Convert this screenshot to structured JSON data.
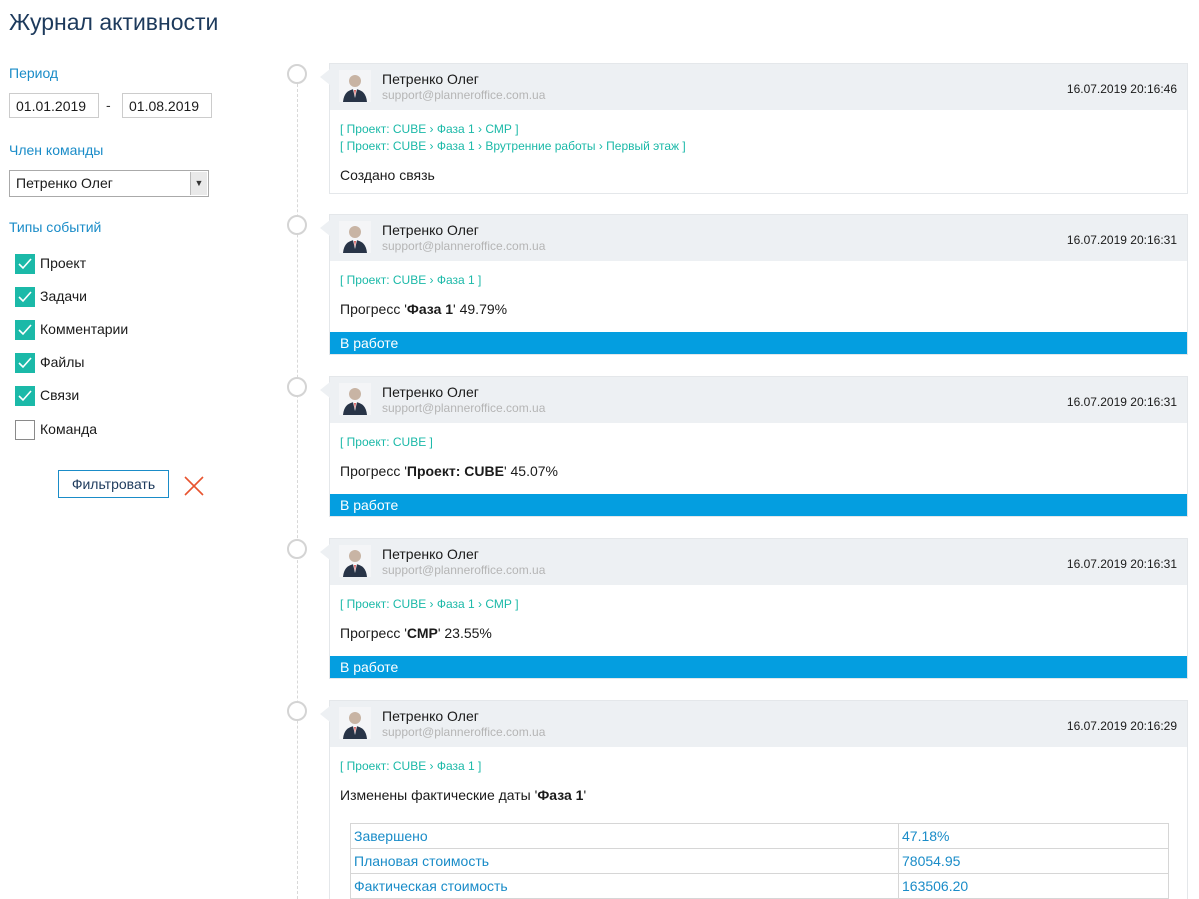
{
  "page": {
    "title": "Журнал активности"
  },
  "filters": {
    "period_label": "Период",
    "date_from": "01.01.2019",
    "date_separator": "-",
    "date_to": "01.08.2019",
    "member_label": "Член команды",
    "member_selected": "Петренко Олег",
    "event_types_label": "Типы событий",
    "event_types": [
      {
        "label": "Проект",
        "checked": true
      },
      {
        "label": "Задачи",
        "checked": true
      },
      {
        "label": "Комментарии",
        "checked": true
      },
      {
        "label": "Файлы",
        "checked": true
      },
      {
        "label": "Связи",
        "checked": true
      },
      {
        "label": "Команда",
        "checked": false
      }
    ],
    "filter_button": "Фильтровать"
  },
  "colors": {
    "accent": "#1a8cc8",
    "teal": "#1bb9a8",
    "status_bar": "#049ee0",
    "clear_icon": "#e8542f"
  },
  "activities": [
    {
      "user": "Петренко Олег",
      "email": "support@planneroffice.com.ua",
      "timestamp": "16.07.2019 20:16:46",
      "breadcrumbs": [
        "[ Проект: CUBE › Фаза 1 › СМР ]",
        "[ Проект: CUBE › Фаза 1 › Врутренние работы › Первый этаж ]"
      ],
      "text": "Создано связь"
    },
    {
      "user": "Петренко Олег",
      "email": "support@planneroffice.com.ua",
      "timestamp": "16.07.2019 20:16:31",
      "breadcrumbs": [
        "[ Проект: CUBE › Фаза 1 ]"
      ],
      "text_prefix": "Прогресс '",
      "text_bold": "Фаза 1",
      "text_suffix": "' 49.79%",
      "status": "В работе"
    },
    {
      "user": "Петренко Олег",
      "email": "support@planneroffice.com.ua",
      "timestamp": "16.07.2019 20:16:31",
      "breadcrumbs": [
        "[ Проект: CUBE ]"
      ],
      "text_prefix": "Прогресс '",
      "text_bold": "Проект: CUBE",
      "text_suffix": "' 45.07%",
      "status": "В работе"
    },
    {
      "user": "Петренко Олег",
      "email": "support@planneroffice.com.ua",
      "timestamp": "16.07.2019 20:16:31",
      "breadcrumbs": [
        "[ Проект: CUBE › Фаза 1 › СМР ]"
      ],
      "text_prefix": "Прогресс '",
      "text_bold": "СМР",
      "text_suffix": "' 23.55%",
      "status": "В работе"
    },
    {
      "user": "Петренко Олег",
      "email": "support@planneroffice.com.ua",
      "timestamp": "16.07.2019 20:16:29",
      "breadcrumbs": [
        "[ Проект: CUBE › Фаза 1 ]"
      ],
      "text_prefix": "Изменены фактические даты '",
      "text_bold": "Фаза 1",
      "text_suffix": "'",
      "table": [
        [
          "Завершено",
          "47.18%"
        ],
        [
          "Плановая стоимость",
          "78054.95"
        ],
        [
          "Фактическая стоимость",
          "163506.20"
        ]
      ]
    }
  ]
}
